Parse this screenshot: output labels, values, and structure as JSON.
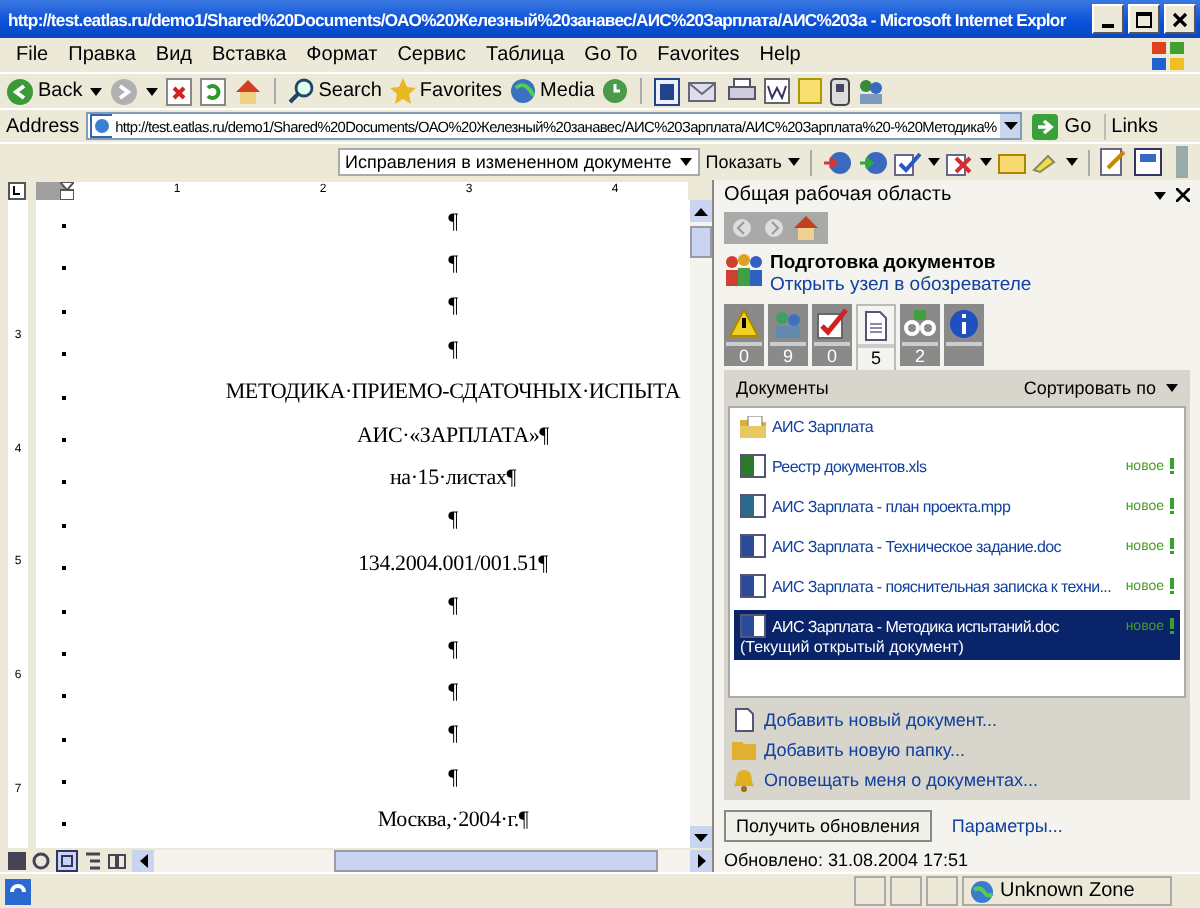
{
  "window": {
    "title": "http://test.eatlas.ru/demo1/Shared%20Documents/ОАО%20Железный%20занавес/АИС%20Зарплата/АИС%203а - Microsoft Internet Explor"
  },
  "menu": [
    "File",
    "Правка",
    "Вид",
    "Вставка",
    "Формат",
    "Сервис",
    "Таблица",
    "Go To",
    "Favorites",
    "Help"
  ],
  "toolbar": {
    "back": "Back",
    "search": "Search",
    "favorites": "Favorites",
    "media": "Media"
  },
  "address_bar": {
    "label": "Address",
    "url": "http://test.eatlas.ru/demo1/Shared%20Documents/ОАО%20Железный%20занавес/АИС%20Зарплата/АИС%20Зарплата%20-%20Методика%",
    "go": "Go",
    "links": "Links"
  },
  "reviewing_toolbar": {
    "display_mode": "Исправления в измененном документе",
    "show": "Показать"
  },
  "ruler": {
    "horizontal": [
      "1",
      "2",
      "3",
      "4"
    ],
    "vertical": [
      "3",
      "4",
      "5",
      "6",
      "7"
    ]
  },
  "document": {
    "paragraphs": [
      {
        "text": "¶"
      },
      {
        "text": "¶"
      },
      {
        "text": "¶"
      },
      {
        "text": "¶"
      },
      {
        "text": "МЕТОДИКА·ПРИЕМО-СДАТОЧНЫХ·ИСПЫТА"
      },
      {
        "text": "АИС·«ЗАРПЛАТА»¶"
      },
      {
        "text": "на·15·листах¶"
      },
      {
        "text": "¶"
      },
      {
        "text": "134.2004.001/001.51¶"
      },
      {
        "text": "¶"
      },
      {
        "text": "¶"
      },
      {
        "text": "¶"
      },
      {
        "text": "¶"
      },
      {
        "text": "¶"
      },
      {
        "text": "Москва,·2004·г.¶"
      }
    ]
  },
  "task_pane": {
    "title": "Общая рабочая область",
    "site_name": "Подготовка документов",
    "site_link": "Открыть узел в обозревателе",
    "tabs": [
      {
        "kind": "warning",
        "count": "0",
        "selected": false
      },
      {
        "kind": "members",
        "count": "9",
        "selected": false
      },
      {
        "kind": "tasks",
        "count": "0",
        "selected": false
      },
      {
        "kind": "documents",
        "count": "5",
        "selected": true
      },
      {
        "kind": "links",
        "count": "2",
        "selected": false
      },
      {
        "kind": "info",
        "selected": false
      }
    ],
    "list_title": "Документы",
    "sort_label": "Сортировать по",
    "items": [
      {
        "kind": "folder",
        "name": "АИС Зарплата",
        "selected": false
      },
      {
        "kind": "xls",
        "name": "Реестр документов.xls",
        "badge": "новое",
        "selected": false
      },
      {
        "kind": "mpp",
        "name": "АИС Зарплата - план проекта.mpp",
        "badge": "новое",
        "selected": false
      },
      {
        "kind": "doc",
        "name": "АИС Зарплата - Техническое задание.doc",
        "badge": "новое",
        "selected": false
      },
      {
        "kind": "doc",
        "name": "АИС Зарплата - пояснительная записка к техни...",
        "badge": "новое",
        "selected": false
      },
      {
        "kind": "doc",
        "name": "АИС Зарплата - Методика испытаний.doc",
        "badge": "новое",
        "note": "(Текущий открытый документ)",
        "selected": true
      }
    ],
    "actions": [
      {
        "kind": "document",
        "label": "Добавить новый документ..."
      },
      {
        "kind": "folder",
        "label": "Добавить новую папку..."
      },
      {
        "kind": "alert",
        "label": "Оповещать меня о документах..."
      }
    ],
    "update_button": "Получить обновления",
    "options_link": "Параметры...",
    "updated": "Обновлено: 31.08.2004 17:51"
  },
  "status_bar": {
    "zone": "Unknown Zone"
  }
}
